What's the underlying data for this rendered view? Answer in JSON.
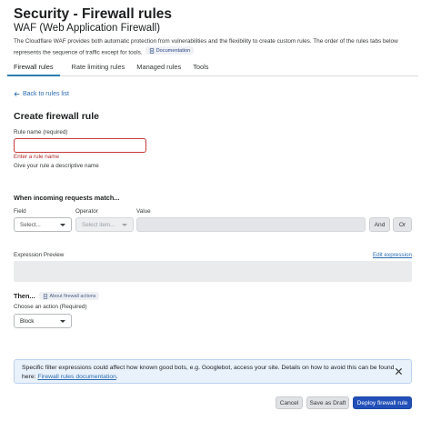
{
  "header": {
    "title": "Security - Firewall rules",
    "subtitle": "WAF (Web Application Firewall)",
    "description": "The Cloudflare WAF provides both automatic protection from vulnerabilities and the flexibility to create custom rules. The order of the rules tabs below represents the sequence of traffic except for tools.",
    "doc_link": "Documentation"
  },
  "tabs": [
    {
      "label": "Firewall rules",
      "active": true
    },
    {
      "label": "Rate limiting rules",
      "active": false
    },
    {
      "label": "Managed rules",
      "active": false
    },
    {
      "label": "Tools",
      "active": false
    }
  ],
  "back_link": "Back to rules list",
  "form": {
    "title": "Create firewall rule",
    "rule_name": {
      "label": "Rule name (required)",
      "value": "",
      "error": "Enter a rule name",
      "help": "Give your rule a descriptive name"
    },
    "match": {
      "heading": "When incoming requests match...",
      "field_label": "Field",
      "field_placeholder": "Select...",
      "operator_label": "Operator",
      "operator_placeholder": "Select item...",
      "value_label": "Value",
      "and_label": "And",
      "or_label": "Or"
    },
    "expression": {
      "label": "Expression Preview",
      "edit_link": "Edit expression"
    },
    "then": {
      "heading": "Then...",
      "about_link": "About firewall actions",
      "action_label": "Choose an action (Required)",
      "action_value": "Block"
    }
  },
  "notice": {
    "text": "Specific filter expressions could affect how known good bots, e.g. Googlebot, access your site. Details on how to avoid this can be found here:",
    "link": "Firewall rules documentation",
    "suffix": "."
  },
  "actions": {
    "cancel": "Cancel",
    "draft": "Save as Draft",
    "deploy": "Deploy firewall rule"
  },
  "colors": {
    "primary": "#2250b8",
    "link": "#2c6cb0",
    "error": "#c63a3a",
    "notice_bg": "#e9f1fb"
  }
}
